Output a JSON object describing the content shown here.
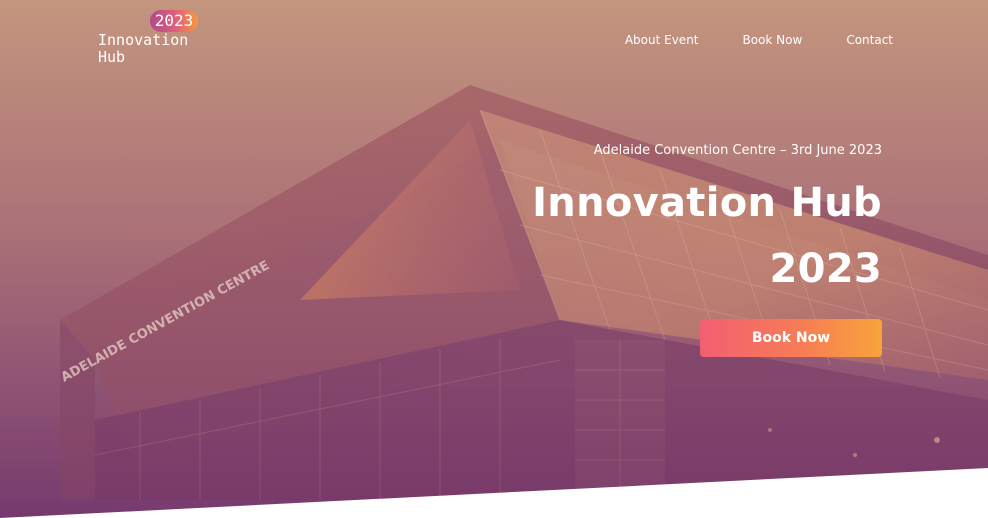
{
  "logo": {
    "year": "2023",
    "name": "Innovation\nHub"
  },
  "nav": {
    "items": [
      {
        "label": "About Event"
      },
      {
        "label": "Book Now"
      },
      {
        "label": "Contact"
      }
    ]
  },
  "hero": {
    "subtitle": "Adelaide Convention Centre – 3rd June 2023",
    "title_line1": "Innovation Hub",
    "title_line2": "2023",
    "cta_label": "Book Now",
    "building_sign": "ADELAIDE CONVENTION CENTRE"
  },
  "colors": {
    "overlay_top": "#c4927a",
    "overlay_bottom": "#7a3c6e",
    "cta_start": "#f25f73",
    "cta_end": "#f7a43a"
  }
}
